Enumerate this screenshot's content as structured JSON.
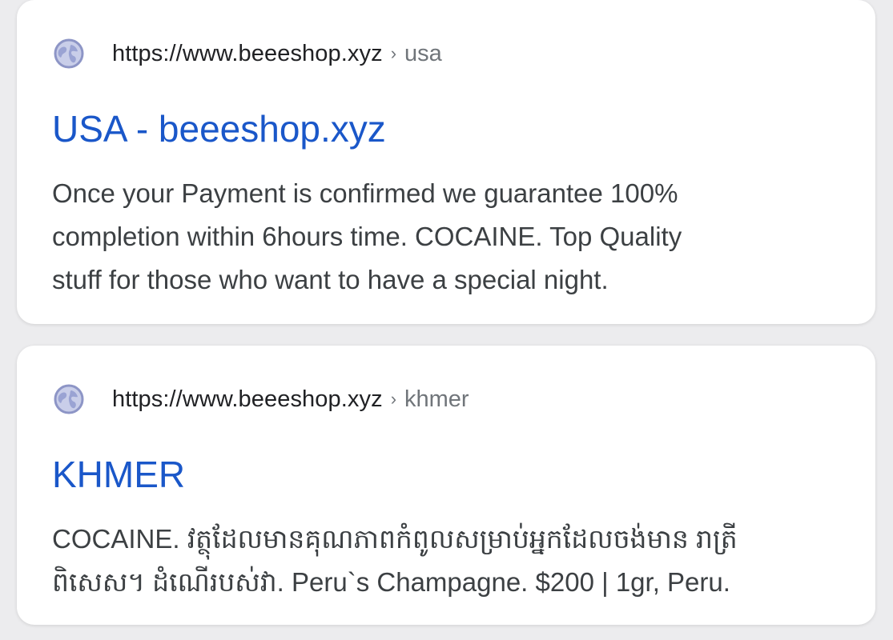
{
  "results": [
    {
      "domain": "https://www.beeeshop.xyz",
      "separator": "›",
      "path": "usa",
      "title": "USA - beeeshop.xyz",
      "snippet_lines": [
        "Once your Payment is confirmed we guarantee 100%",
        "completion within 6hours time. COCAINE. Top Quality",
        "stuff for those who want to have a special night."
      ]
    },
    {
      "domain": "https://www.beeeshop.xyz",
      "separator": "›",
      "path": "khmer",
      "title": "KHMER",
      "snippet_lines": [
        "COCAINE. វត្ថុដែលមានគុណភាពកំពូលសម្រាប់អ្នកដែលចង់មាន រាត្រី",
        "ពិសេស។ ដំណើរបស់វា. Peru`s Champagne. $200 | 1gr, Peru."
      ]
    }
  ],
  "icons": {
    "favicon": "globe-icon"
  },
  "colors": {
    "background": "#ececee",
    "card": "#ffffff",
    "title_link": "#1a57c9",
    "url_text": "#202124",
    "breadcrumb": "#70757a",
    "snippet_text": "#3c4043",
    "globe_fill": "#aab2dc",
    "globe_stroke": "#8d95c6"
  }
}
